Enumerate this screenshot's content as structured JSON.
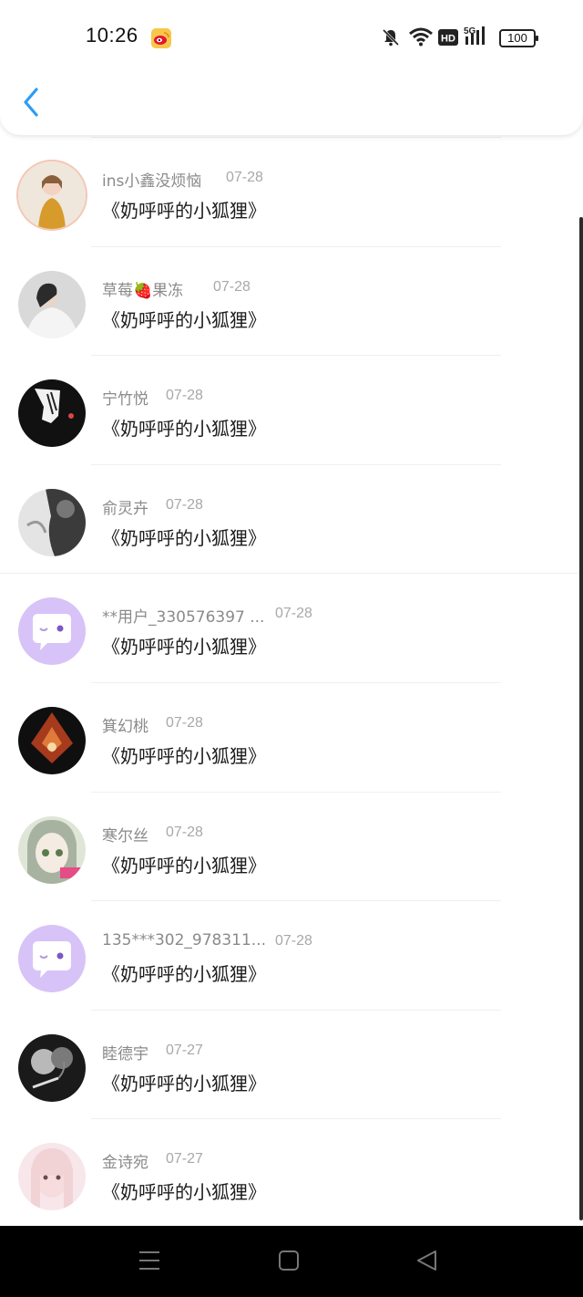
{
  "status_bar": {
    "time": "10:26",
    "battery": "100",
    "icons": [
      "weibo-icon",
      "bell-mute-icon",
      "wifi-icon",
      "hd-icon",
      "5g-signal-icon",
      "battery-icon"
    ]
  },
  "header": {
    "back_icon": "chevron-left-icon"
  },
  "messages": [
    {
      "name": "ins小鑫没烦恼",
      "date": "07-28",
      "text": "《奶呼呼的小狐狸》",
      "avatar": "photo-girl-yellow-coat"
    },
    {
      "name": "草莓🍓果冻",
      "date": "07-28",
      "text": "《奶呼呼的小狐狸》",
      "avatar": "photo-girl-white"
    },
    {
      "name": "宁竹悦",
      "date": "07-28",
      "text": "《奶呼呼的小狐狸》",
      "avatar": "dark-drawing-hand"
    },
    {
      "name": "俞灵卉",
      "date": "07-28",
      "text": "《奶呼呼的小狐狸》",
      "avatar": "dark-portrait-smoke"
    },
    {
      "name": "**用户_330576397 ...",
      "date": "07-28",
      "text": "《奶呼呼的小狐狸》",
      "avatar": "default-chat-bubble"
    },
    {
      "name": "箕幻桃",
      "date": "07-28",
      "text": "《奶呼呼的小狐狸》",
      "avatar": "red-orchid"
    },
    {
      "name": "寒尔丝",
      "date": "07-28",
      "text": "《奶呼呼的小狐狸》",
      "avatar": "anime-girl"
    },
    {
      "name": "135***302_978311...",
      "date": "07-28",
      "text": "《奶呼呼的小狐狸》",
      "avatar": "default-chat-bubble"
    },
    {
      "name": "睦德宇",
      "date": "07-27",
      "text": "《奶呼呼的小狐狸》",
      "avatar": "dark-couple-smoke"
    },
    {
      "name": "金诗宛",
      "date": "07-27",
      "text": "《奶呼呼的小狐狸》",
      "avatar": "photo-girl-pink"
    }
  ],
  "nav_bar": {
    "buttons": [
      "menu-icon",
      "home-icon",
      "back-triangle-icon"
    ]
  },
  "colors": {
    "accent": "#2a9df4",
    "default_avatar_bg": "#d7c3f7"
  }
}
